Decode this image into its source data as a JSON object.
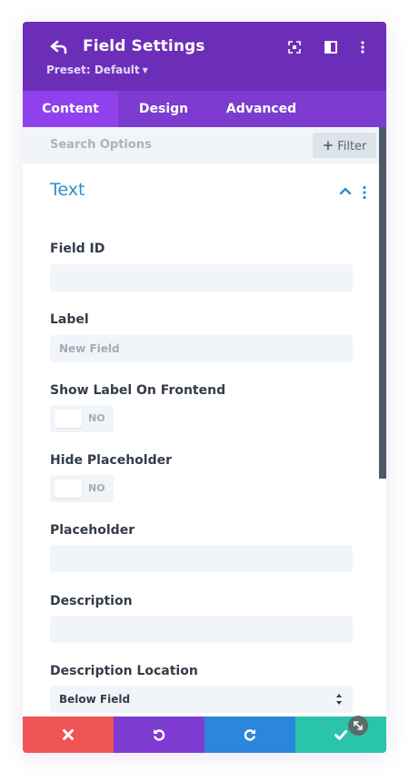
{
  "header": {
    "title": "Field Settings",
    "preset": "Preset: Default",
    "color": "#6c2eb9"
  },
  "tabs": [
    {
      "label": "Content",
      "active": true
    },
    {
      "label": "Design",
      "active": false
    },
    {
      "label": "Advanced",
      "active": false
    }
  ],
  "search": {
    "placeholder": "Search Options",
    "filter_label": "Filter"
  },
  "section": {
    "title": "Text",
    "color": "#2e8ec9"
  },
  "fields": {
    "field_id": {
      "label": "Field ID",
      "value": ""
    },
    "label": {
      "label": "Label",
      "placeholder": "New Field"
    },
    "show_label": {
      "label": "Show Label On Frontend",
      "toggle": "NO"
    },
    "hide_placeholder": {
      "label": "Hide Placeholder",
      "toggle": "NO"
    },
    "placeholder": {
      "label": "Placeholder",
      "value": ""
    },
    "description": {
      "label": "Description",
      "value": ""
    },
    "description_location": {
      "label": "Description Location",
      "value": "Below Field"
    }
  },
  "footer": {
    "cancel_color": "#ef5555",
    "undo_color": "#7e3bd0",
    "redo_color": "#2b87da",
    "save_color": "#29c4a9"
  }
}
